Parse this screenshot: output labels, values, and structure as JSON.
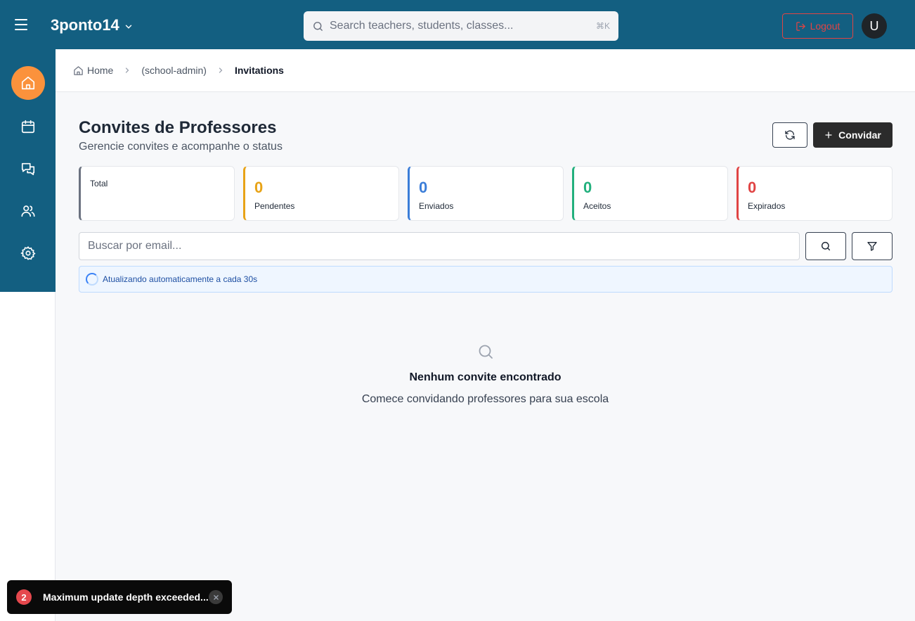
{
  "header": {
    "brand": "3ponto14",
    "search_placeholder": "Search teachers, students, classes...",
    "search_shortcut": "⌘K",
    "logout_label": "Logout",
    "avatar_initial": "U"
  },
  "sidebar": {
    "items": [
      {
        "icon": "home-icon",
        "active": true
      },
      {
        "icon": "calendar-icon",
        "active": false
      },
      {
        "icon": "messages-icon",
        "active": false
      },
      {
        "icon": "users-icon",
        "active": false
      },
      {
        "icon": "settings-icon",
        "active": false
      }
    ]
  },
  "breadcrumb": {
    "home": "Home",
    "section": "(school-admin)",
    "current": "Invitations"
  },
  "page": {
    "title": "Convites de Professores",
    "subtitle": "Gerencie convites e acompanhe o status",
    "invite_label": "Convidar"
  },
  "stats": {
    "total": {
      "label": "Total",
      "color": "#6b7280"
    },
    "pending": {
      "value": "0",
      "label": "Pendentes",
      "color": "#e8a317"
    },
    "sent": {
      "value": "0",
      "label": "Enviados",
      "color": "#3b7dd8"
    },
    "accepted": {
      "value": "0",
      "label": "Aceitos",
      "color": "#22b07d"
    },
    "expired": {
      "value": "0",
      "label": "Expirados",
      "color": "#e04444"
    }
  },
  "filters": {
    "email_placeholder": "Buscar por email..."
  },
  "auto_refresh": {
    "text": "Atualizando automaticamente a cada 30s"
  },
  "empty_state": {
    "title": "Nenhum convite encontrado",
    "subtitle": "Comece convidando professores para sua escola"
  },
  "toast": {
    "count": "2",
    "message": "Maximum update depth exceeded..."
  }
}
